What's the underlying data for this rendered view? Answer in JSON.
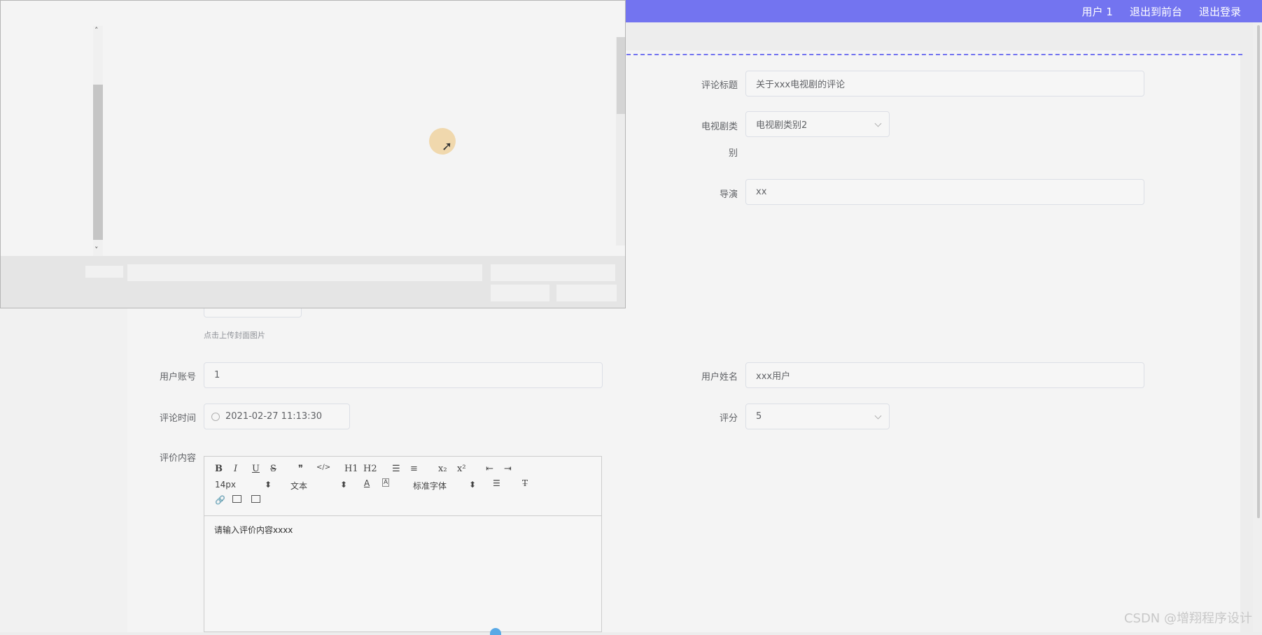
{
  "topbar": {
    "links": [
      "用户 1",
      "退出到前台",
      "退出登录"
    ],
    "color": "#7374f0"
  },
  "form": {
    "comment_title": {
      "label": "评论标题",
      "value": "关于xxx电视剧的评论"
    },
    "category": {
      "label_line1": "电视剧类",
      "label_line2": "别",
      "value": "电视剧类别2"
    },
    "director": {
      "label": "导演",
      "value": "xx"
    },
    "cover_hint": "点击上传封面图片",
    "user_account": {
      "label": "用户账号",
      "value": "1"
    },
    "user_name": {
      "label": "用户姓名",
      "value": "xxx用户"
    },
    "comment_time": {
      "label": "评论时间",
      "value": "2021-02-27 11:13:30"
    },
    "rating": {
      "label": "评分",
      "value": "5"
    },
    "content": {
      "label": "评价内容",
      "value": "请输入评价内容xxxx"
    }
  },
  "editor": {
    "toolbar_row1": [
      "B",
      "I",
      "U",
      "S",
      "❞",
      "</>",
      "H1",
      "H2",
      "☰",
      "≡",
      "x₂",
      "x²",
      "⇤",
      "⇥"
    ],
    "font_size": "14px",
    "header_select": "文本",
    "font_family": "标准字体"
  },
  "watermark": "CSDN @增翔程序设计"
}
